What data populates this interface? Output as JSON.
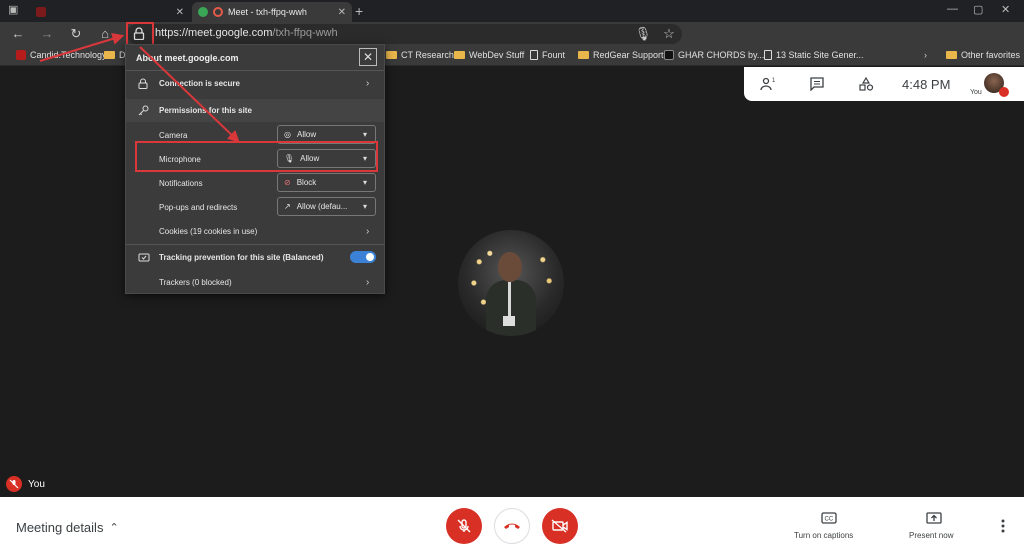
{
  "browser": {
    "tabs": [
      {
        "title": "",
        "active": false
      },
      {
        "title": "Meet - txh-ffpq-wwh",
        "active": true
      }
    ],
    "address": {
      "host": "https://meet.google.com",
      "path": "/txh-ffpq-wwh"
    },
    "bookmarks": [
      {
        "label": "Candid.Technology",
        "icon": "site-icon"
      },
      {
        "label": "D",
        "icon": "folder-icon"
      },
      {
        "label": "CT Research",
        "icon": "folder-icon"
      },
      {
        "label": "WebDev Stuff",
        "icon": "folder-icon"
      },
      {
        "label": "Fount",
        "icon": "doc-icon"
      },
      {
        "label": "RedGear Support",
        "icon": "folder-icon"
      },
      {
        "label": "GHAR CHORDS by...",
        "icon": "site-icon"
      },
      {
        "label": "13 Static Site Gener...",
        "icon": "doc-icon"
      },
      {
        "label": "Other favorites",
        "icon": "folder-icon"
      }
    ]
  },
  "popup": {
    "title": "About meet.google.com",
    "connection": "Connection is secure",
    "permissions_header": "Permissions for this site",
    "permissions": [
      {
        "label": "Camera",
        "value": "Allow",
        "icon": "camera-icon"
      },
      {
        "label": "Microphone",
        "value": "Allow",
        "icon": "mic-icon"
      },
      {
        "label": "Notifications",
        "value": "Block",
        "icon": "bell-icon"
      },
      {
        "label": "Pop-ups and redirects",
        "value": "Allow (defau...",
        "icon": "popup-icon"
      }
    ],
    "cookies": "Cookies (19 cookies in use)",
    "tracking": "Tracking prevention for this site (Balanced)",
    "tracking_enabled": true,
    "trackers": "Trackers (0 blocked)"
  },
  "meet": {
    "time": "4:48 PM",
    "you_label": "You",
    "participant_label": "You",
    "meeting_details": "Meeting details",
    "captions_label": "Turn on captions",
    "present_label": "Present now"
  },
  "colors": {
    "accent_red": "#d93025",
    "highlight_red": "#d9373a",
    "toggle_blue": "#3b82d6"
  }
}
